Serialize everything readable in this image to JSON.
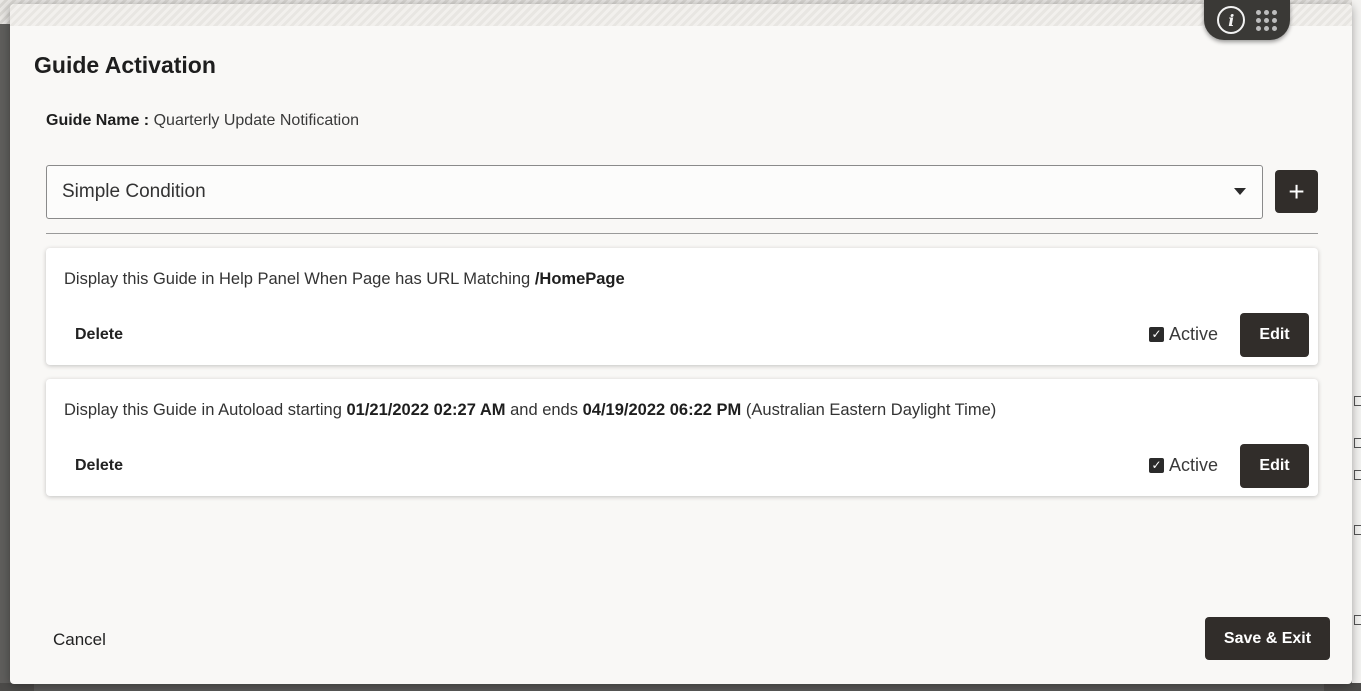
{
  "dialog": {
    "title": "Guide Activation",
    "guide_name_label": "Guide Name :",
    "guide_name_value": "Quarterly Update Notification"
  },
  "condition_select": {
    "selected": "Simple Condition",
    "add_label": "+"
  },
  "rules": [
    {
      "text_prefix": "Display this Guide in Help Panel When Page has URL Matching",
      "text_bold": "/HomePage",
      "delete_label": "Delete",
      "active_label": "Active",
      "active_checked": true,
      "edit_label": "Edit"
    },
    {
      "text_prefix": "Display this Guide in Autoload starting",
      "start": "01/21/2022 02:27 AM",
      "mid": "and ends",
      "end": "04/19/2022 06:22 PM",
      "timezone": "(Australian Eastern Daylight Time)",
      "delete_label": "Delete",
      "active_label": "Active",
      "active_checked": true,
      "edit_label": "Edit"
    }
  ],
  "footer": {
    "cancel_label": "Cancel",
    "save_label": "Save & Exit"
  },
  "widget": {
    "info_glyph": "i",
    "icons": [
      "info-icon",
      "app-grid-icon"
    ]
  },
  "colors": {
    "primary_button": "#312d2a",
    "modal_bg": "#f9f8f6",
    "card_bg": "#ffffff"
  }
}
